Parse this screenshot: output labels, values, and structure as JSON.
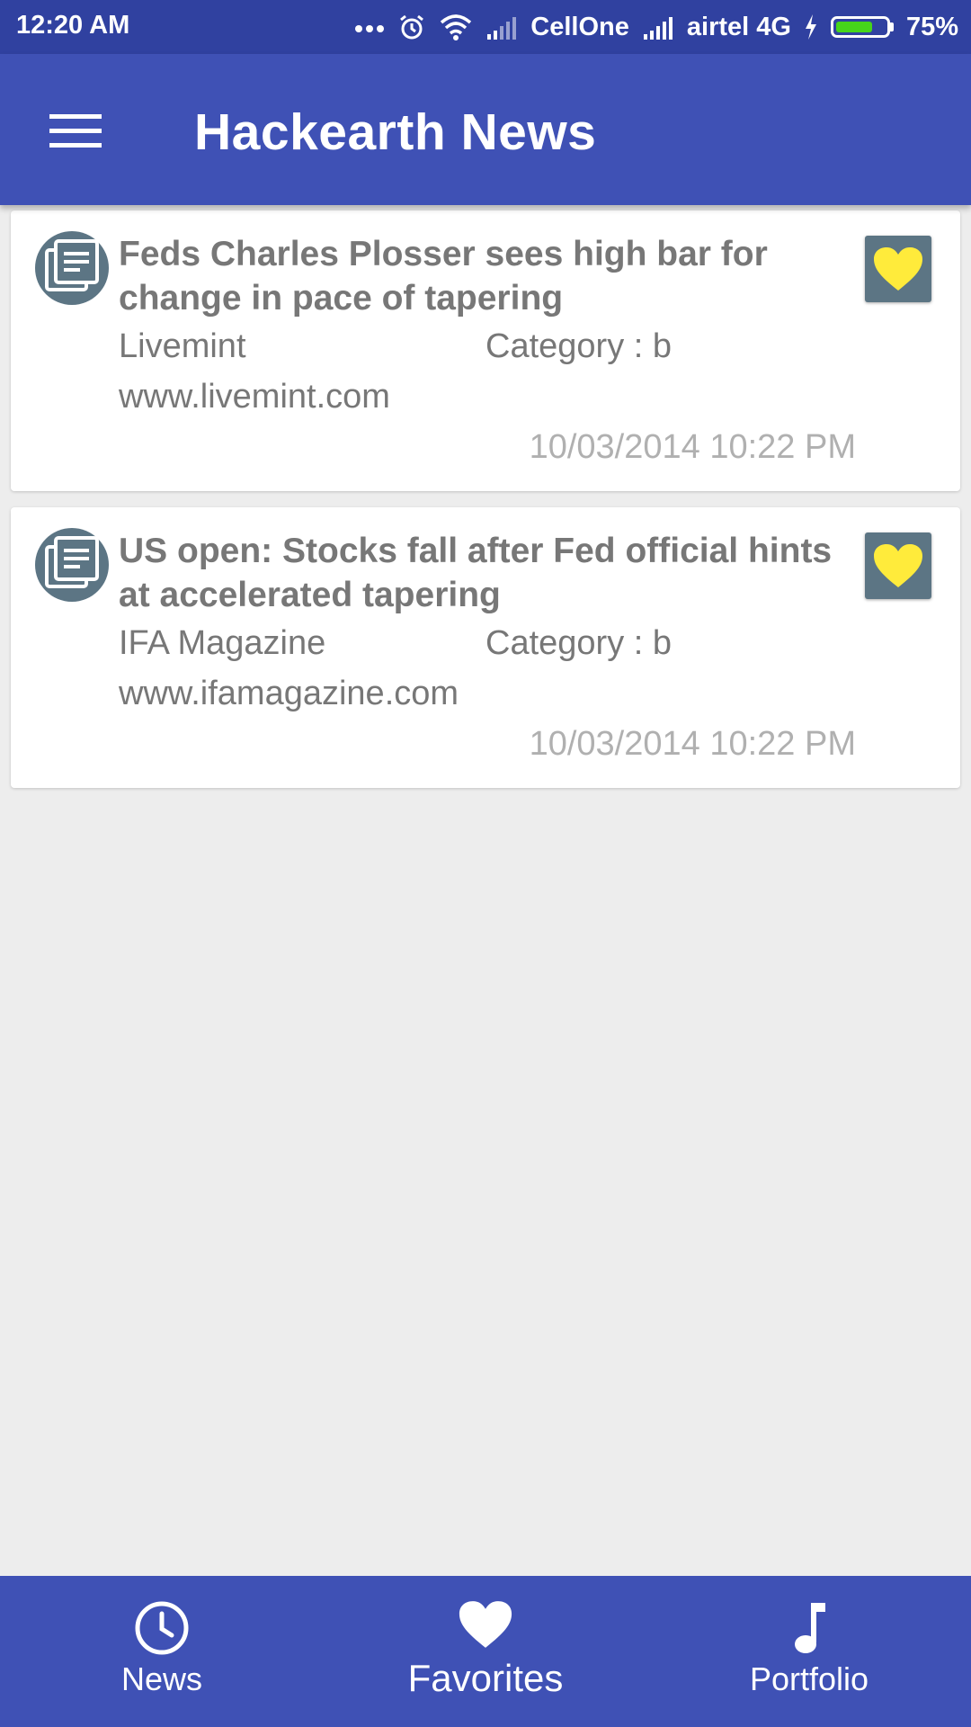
{
  "status_bar": {
    "time": "12:20 AM",
    "carrier_1": "CellOne",
    "carrier_2": "airtel 4G",
    "battery_percent": "75%",
    "battery_level": 0.75,
    "icons": [
      "more-dots-icon",
      "alarm-icon",
      "wifi-icon",
      "signal-icon",
      "signal-icon",
      "charging-icon",
      "battery-icon"
    ]
  },
  "app_bar": {
    "title": "Hackearth News",
    "menu_icon": "hamburger-menu-icon"
  },
  "articles": [
    {
      "title": "Feds Charles Plosser sees high bar for change in pace of tapering",
      "source": "Livemint",
      "category": "Category : b",
      "domain": "www.livemint.com",
      "timestamp": "10/03/2014 10:22 PM",
      "icon": "news-article-icon",
      "favorite_icon": "heart-icon"
    },
    {
      "title": "US open: Stocks fall after Fed official hints at accelerated tapering",
      "source": "IFA Magazine",
      "category": "Category : b",
      "domain": "www.ifamagazine.com",
      "timestamp": "10/03/2014 10:22 PM",
      "icon": "news-article-icon",
      "favorite_icon": "heart-icon"
    }
  ],
  "bottom_nav": {
    "items": [
      {
        "label": "News",
        "icon": "clock-icon"
      },
      {
        "label": "Favorites",
        "icon": "heart-icon",
        "active": true
      },
      {
        "label": "Portfolio",
        "icon": "music-note-icon"
      }
    ]
  },
  "colors": {
    "primary": "#3f51b5",
    "primary_dark": "#3041a0",
    "favorite_heart": "#ffeb3b",
    "favorite_bg": "#5c7584",
    "text_secondary": "#777777",
    "timestamp": "#b0b0b0",
    "background": "#ededed"
  }
}
